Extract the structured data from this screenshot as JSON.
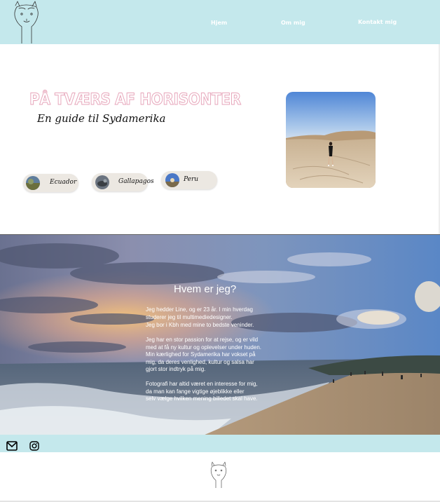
{
  "header": {
    "nav": [
      "Hjem",
      "Om mig",
      "Kontakt mig"
    ],
    "logo_icon": "alpaca-icon"
  },
  "hero": {
    "title": "PÅ TVÆRS AF HORISONTER",
    "subtitle": "En guide til Sydamerika",
    "photo": "desert-dunes-photo",
    "destinations": [
      "Ecuador",
      "Gallapagos",
      "Peru"
    ]
  },
  "about": {
    "title": "Hvem er jeg?",
    "lines": [
      "Jeg hedder Line, og er 23 år. I min hverdag",
      "studerer jeg til multimediedesigner.",
      "Jeg bor i Kbh med mine to bedste veninder.",
      "",
      "Jeg har en stor passion for at rejse, og er vild",
      "med at få ny kultur og oplevelser under huden.",
      "Min kærlighed for Sydamerika har vokset på",
      "mig, da deres venlighed, kultur og salsa har",
      "gjort stor indtryk på mig.",
      "",
      "Fotografi har altid været en interesse for mig,",
      "da man kan fange vigtige øjeblikke eller",
      "selv vælge hvilken mening billedet skal have."
    ],
    "background": "beach-sunset-photo"
  },
  "footer": {
    "icons": [
      "mail-icon",
      "instagram-icon"
    ],
    "logo_icon": "alpaca-icon"
  },
  "colors": {
    "accent": "#c4e8ec",
    "title_outline": "#e6a3b8",
    "pill": "#ece8e2"
  }
}
